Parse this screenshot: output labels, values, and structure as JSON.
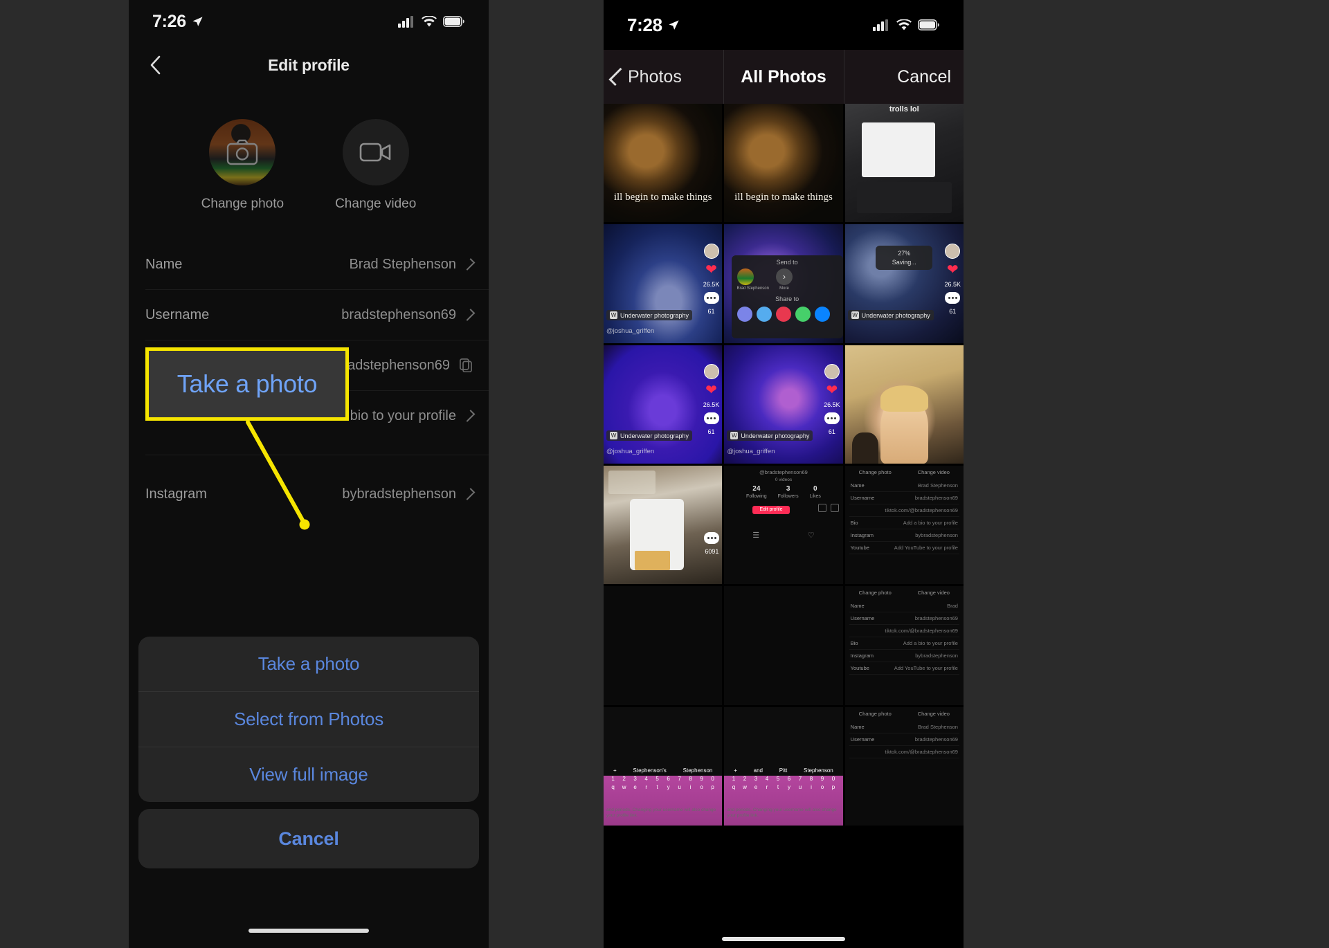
{
  "left_phone": {
    "status_bar": {
      "time": "7:26",
      "location_icon": "location-arrow-icon",
      "cellular_icon": "cellular-bars-icon",
      "wifi_icon": "wifi-icon",
      "battery_icon": "battery-icon"
    },
    "nav": {
      "back_icon": "chevron-left-icon",
      "title": "Edit profile"
    },
    "avatars": [
      {
        "icon": "camera-icon",
        "label": "Change photo"
      },
      {
        "icon": "video-camera-icon",
        "label": "Change video"
      }
    ],
    "fields": [
      {
        "label": "Name",
        "value": "Brad Stephenson",
        "accessory": "chevron-right-icon"
      },
      {
        "label": "Username",
        "value": "bradstephenson69",
        "accessory": "chevron-right-icon"
      },
      {
        "label": "",
        "value": "tiktok.com/@bradstephenson69",
        "accessory": "copy-icon"
      },
      {
        "label": "Bio",
        "value": "Add a bio to your profile",
        "accessory": "chevron-right-icon"
      },
      {
        "label": "Instagram",
        "value": "bybradstephenson",
        "accessory": "chevron-right-icon"
      }
    ],
    "callout": {
      "text": "Take a photo",
      "border_color": "#f6e500",
      "text_color": "#6fa3f7"
    },
    "action_sheet": {
      "items": [
        "Take a photo",
        "Select from Photos",
        "View full image"
      ],
      "cancel": "Cancel"
    }
  },
  "right_phone": {
    "status_bar": {
      "time": "7:28",
      "location_icon": "location-arrow-icon",
      "cellular_icon": "cellular-bars-icon",
      "wifi_icon": "wifi-icon",
      "battery_icon": "battery-icon"
    },
    "picker_bar": {
      "back_label": "Photos",
      "back_icon": "chevron-left-icon",
      "title": "All Photos",
      "cancel": "Cancel"
    },
    "selected_photo_index": 8,
    "selection_border_color": "#f6e500",
    "photo_grid": [
      {
        "name": "old-man-caption-1",
        "art": "art-oldman",
        "caption": "ill begin to make things"
      },
      {
        "name": "old-man-caption-2",
        "art": "art-oldman",
        "caption": "ill begin to make things"
      },
      {
        "name": "trolls-screenshot",
        "art": "art-screenshot",
        "caption": "trolls lol"
      },
      {
        "name": "underwater-dancer",
        "art": "art-underwater1",
        "tag": "Underwater photography",
        "likes": "26.5K",
        "comments": "61",
        "user": "@joshua_griffen"
      },
      {
        "name": "share-sheet-screenshot",
        "art": "art-stage1",
        "share_overlay": true,
        "send_to": "Send to",
        "share_to": "Share to",
        "more": "More",
        "person": "Brad Stephenson"
      },
      {
        "name": "saving-video",
        "art": "art-night1",
        "progress": "27%",
        "status": "Saving...",
        "tag": "Underwater photography",
        "likes": "26.5K",
        "comments": "61"
      },
      {
        "name": "blue-stage-left",
        "art": "art-blue1",
        "tag": "Underwater photography",
        "likes": "26.5K",
        "comments": "61",
        "user": "@joshua_griffen"
      },
      {
        "name": "blue-stage-mid",
        "art": "art-blue2",
        "tag": "Underwater photography",
        "likes": "26.5K",
        "comments": "61",
        "user": "@joshua_griffen"
      },
      {
        "name": "selfie-portrait",
        "art": "art-portrait",
        "selected": true
      },
      {
        "name": "kitchen-chips",
        "art": "art-kitchen",
        "comments": "6091"
      },
      {
        "name": "profile-stats-screenshot",
        "art": "art-profile",
        "handle": "@bradstephenson69",
        "videos": "0 videos",
        "following": "24",
        "followers": "3",
        "likes_count": "0",
        "edit_profile": "Edit profile"
      },
      {
        "name": "edit-profile-screenshot-1",
        "art": "art-profile"
      },
      {
        "name": "dark-cell-1",
        "art": "art-dark"
      },
      {
        "name": "dark-cell-2",
        "art": "art-dark"
      },
      {
        "name": "edit-profile-screenshot-2",
        "art": "art-profile"
      },
      {
        "name": "keyboard-screenshot-1",
        "art": "art-keyboard",
        "suggestions": [
          "Stephenson's",
          "Stephenson"
        ]
      },
      {
        "name": "keyboard-screenshot-2",
        "art": "art-keyboard",
        "suggestions": [
          "and",
          "Pitt",
          "Stephenson"
        ]
      },
      {
        "name": "edit-profile-screenshot-3",
        "art": "art-profile"
      }
    ],
    "mini_profile": {
      "change_photo": "Change photo",
      "change_video": "Change video",
      "rows": [
        {
          "label": "Name",
          "value": "Brad Stephenson"
        },
        {
          "label": "Username",
          "value": "bradstephenson69"
        },
        {
          "label": "",
          "value": "tiktok.com/@bradstephenson69"
        },
        {
          "label": "Bio",
          "value": "Add a bio to your profile"
        },
        {
          "label": "Instagram",
          "value": "bybradstephenson"
        },
        {
          "label": "Youtube",
          "value": "Add YouTube to your profile"
        }
      ],
      "rows_short": [
        {
          "label": "Name",
          "value": "Brad"
        },
        {
          "label": "Username",
          "value": "bradstephenson69"
        },
        {
          "label": "",
          "value": "tiktok.com/@bradstephenson69"
        },
        {
          "label": "Bio",
          "value": "Add a bio to your profile"
        },
        {
          "label": "Instagram",
          "value": "bybradstephenson"
        },
        {
          "label": "Youtube",
          "value": "Add YouTube to your profile"
        }
      ],
      "stats": [
        {
          "value": "24",
          "label": "Following"
        },
        {
          "value": "3",
          "label": "Followers"
        },
        {
          "value": "0",
          "label": "Likes"
        }
      ],
      "note": "and periods. Changing your username will also change your profile link."
    },
    "keyboard": {
      "numbers": [
        "1",
        "2",
        "3",
        "4",
        "5",
        "6",
        "7",
        "8",
        "9",
        "0"
      ],
      "letters": [
        "q",
        "w",
        "e",
        "r",
        "t",
        "y",
        "u",
        "i",
        "o",
        "p"
      ]
    }
  }
}
